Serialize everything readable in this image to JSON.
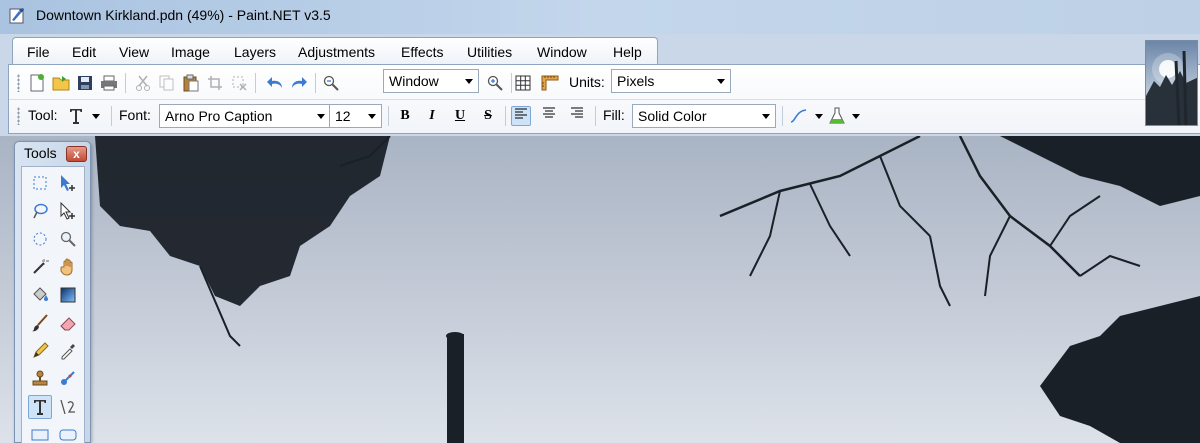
{
  "window": {
    "title": "Downtown Kirkland.pdn (49%) - Paint.NET v3.5",
    "icon": "paint-net-app-icon"
  },
  "menu": [
    "File",
    "Edit",
    "View",
    "Image",
    "Layers",
    "Adjustments",
    "Effects",
    "Utilities",
    "Window",
    "Help"
  ],
  "toolbar": {
    "zoom_value": "Window",
    "units_label": "Units:",
    "units_value": "Pixels",
    "tool_label": "Tool:",
    "font_label": "Font:",
    "font_value": "Arno Pro Caption",
    "font_size": "12",
    "bold": "B",
    "italic": "I",
    "underline": "U",
    "strike": "S",
    "fill_label": "Fill:",
    "fill_value": "Solid Color"
  },
  "tools_window": {
    "title": "Tools",
    "close": "x"
  },
  "colors": {
    "accent": "#3d7bd1",
    "close": "#c14b36"
  }
}
